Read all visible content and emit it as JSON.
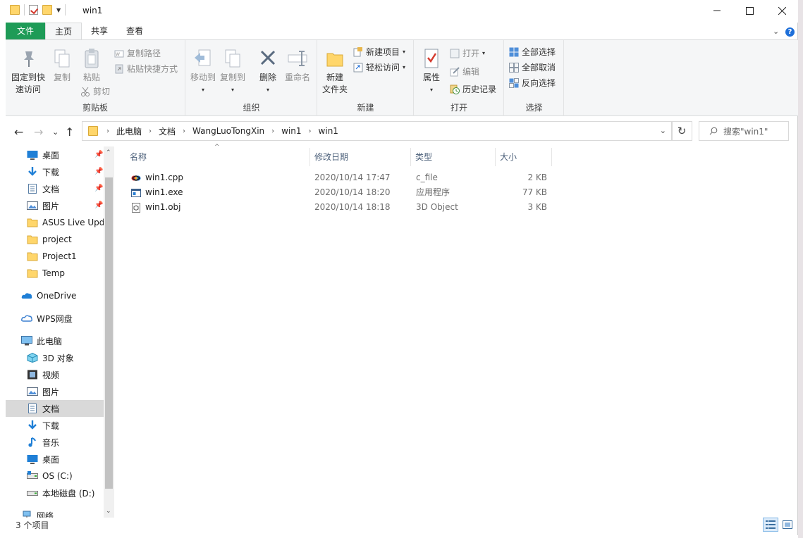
{
  "window": {
    "title": "win1"
  },
  "ribbon": {
    "tabs": [
      "文件",
      "主页",
      "共享",
      "查看"
    ],
    "clipboard": {
      "group_label": "剪贴板",
      "pin_quick_access": "固定到快\n速访问",
      "copy": "复制",
      "paste": "粘贴",
      "copy_path": "复制路径",
      "paste_shortcut": "粘贴快捷方式",
      "cut": "剪切"
    },
    "organize": {
      "group_label": "组织",
      "move_to": "移动到",
      "copy_to": "复制到",
      "delete": "删除",
      "rename": "重命名"
    },
    "new": {
      "group_label": "新建",
      "new_folder": "新建\n文件夹",
      "new_item": "新建项目",
      "easy_access": "轻松访问"
    },
    "open": {
      "group_label": "打开",
      "properties": "属性",
      "open": "打开",
      "edit": "编辑",
      "history": "历史记录"
    },
    "select": {
      "group_label": "选择",
      "select_all": "全部选择",
      "select_none": "全部取消",
      "invert": "反向选择"
    }
  },
  "address": {
    "crumbs": [
      "此电脑",
      "文档",
      "WangLuoTongXin",
      "win1",
      "win1"
    ],
    "search_placeholder": "搜索\"win1\""
  },
  "nav_pane": {
    "quick_access": [
      {
        "label": "桌面",
        "icon": "desktop-icon",
        "pinned": true
      },
      {
        "label": "下载",
        "icon": "download-icon",
        "pinned": true
      },
      {
        "label": "文档",
        "icon": "document-icon",
        "pinned": true
      },
      {
        "label": "图片",
        "icon": "pictures-icon",
        "pinned": true
      },
      {
        "label": "ASUS Live Upd",
        "icon": "folder-icon",
        "pinned": false
      },
      {
        "label": "project",
        "icon": "folder-icon",
        "pinned": false
      },
      {
        "label": "Project1",
        "icon": "folder-icon",
        "pinned": false
      },
      {
        "label": "Temp",
        "icon": "folder-icon",
        "pinned": false
      }
    ],
    "onedrive": "OneDrive",
    "wps": "WPS网盘",
    "this_pc": "此电脑",
    "pc_items": [
      {
        "label": "3D 对象",
        "icon": "3d-objects-icon"
      },
      {
        "label": "视频",
        "icon": "videos-icon"
      },
      {
        "label": "图片",
        "icon": "pictures-icon"
      },
      {
        "label": "文档",
        "icon": "document-icon",
        "selected": true
      },
      {
        "label": "下载",
        "icon": "download-icon"
      },
      {
        "label": "音乐",
        "icon": "music-icon"
      },
      {
        "label": "桌面",
        "icon": "desktop-icon"
      },
      {
        "label": "OS (C:)",
        "icon": "os-drive-icon"
      },
      {
        "label": "本地磁盘 (D:)",
        "icon": "disk-drive-icon"
      }
    ],
    "network": "网络"
  },
  "columns": {
    "name": "名称",
    "modified": "修改日期",
    "type": "类型",
    "size": "大小"
  },
  "files": [
    {
      "name": "win1.cpp",
      "modified": "2020/10/14 17:47",
      "type": "c_file",
      "size": "2 KB",
      "icon": "cpp-file-icon"
    },
    {
      "name": "win1.exe",
      "modified": "2020/10/14 18:20",
      "type": "应用程序",
      "size": "77 KB",
      "icon": "exe-file-icon"
    },
    {
      "name": "win1.obj",
      "modified": "2020/10/14 18:18",
      "type": "3D Object",
      "size": "3 KB",
      "icon": "obj-file-icon"
    }
  ],
  "status": {
    "item_count": "3 个项目"
  }
}
